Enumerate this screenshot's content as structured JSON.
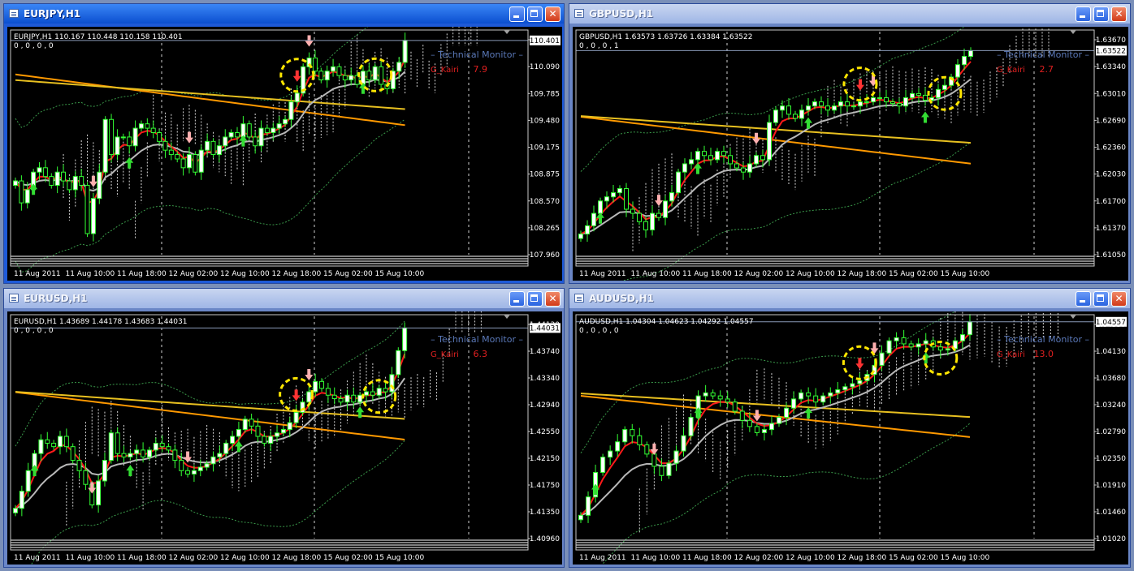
{
  "windows": [
    {
      "title": "EURJPY,H1",
      "active": true,
      "ohlc_line": "EURJPY,H1  110.167 110.448 110.158 110.401",
      "indicator_values": "0 , 0 , 0 , 0",
      "monitor": {
        "label": "Technical  Monitor",
        "name": "G_Kairi",
        "value": "7.9"
      },
      "current_price": "110.401",
      "price_labels": [
        "110.395",
        "110.090",
        "109.785",
        "109.480",
        "109.175",
        "108.875",
        "108.570",
        "108.265",
        "107.960"
      ],
      "time_labels": [
        "11 Aug 2011",
        "11 Aug 10:00",
        "11 Aug 18:00",
        "12 Aug 02:00",
        "12 Aug 10:00",
        "12 Aug 18:00",
        "15 Aug 02:00",
        "15 Aug 10:00"
      ],
      "chart_data": {
        "type": "candlestick",
        "ylim": [
          107.96,
          110.5
        ],
        "closes": [
          108.8,
          108.55,
          108.7,
          108.9,
          108.95,
          108.85,
          108.75,
          108.9,
          108.8,
          108.7,
          108.85,
          108.75,
          108.2,
          108.6,
          108.9,
          109.5,
          109.1,
          109.3,
          109.3,
          109.2,
          109.4,
          109.45,
          109.4,
          109.35,
          109.25,
          109.15,
          109.1,
          109.05,
          108.95,
          109.1,
          108.9,
          109.15,
          109.25,
          109.1,
          109.2,
          109.3,
          109.35,
          109.3,
          109.45,
          109.3,
          109.2,
          109.4,
          109.35,
          109.4,
          109.45,
          109.5,
          109.7,
          109.8,
          110.1,
          110.2,
          110.05,
          109.95,
          110.05,
          110.1,
          110.0,
          109.95,
          110.0,
          109.9,
          110.05,
          109.95,
          110.1,
          109.9,
          109.85,
          110.05,
          110.15,
          110.4
        ]
      }
    },
    {
      "title": "GBPUSD,H1",
      "active": false,
      "ohlc_line": "GBPUSD,H1  1.63573 1.63726 1.63384 1.63522",
      "indicator_values": "0 , 0 , 0 , 1",
      "monitor": {
        "label": "Technical  Monitor",
        "name": "G_Kairi",
        "value": "2.7"
      },
      "current_price": "1.63522",
      "price_labels": [
        "1.63670",
        "1.63340",
        "1.63010",
        "1.62690",
        "1.62360",
        "1.62030",
        "1.61700",
        "1.61370",
        "1.61050"
      ],
      "time_labels": [
        "11 Aug 2011",
        "11 Aug 10:00",
        "11 Aug 18:00",
        "12 Aug 02:00",
        "12 Aug 10:00",
        "12 Aug 18:00",
        "15 Aug 02:00",
        "15 Aug 10:00"
      ],
      "chart_data": {
        "type": "candlestick",
        "ylim": [
          1.6105,
          1.6375
        ],
        "closes": [
          1.613,
          1.614,
          1.6155,
          1.617,
          1.6175,
          1.618,
          1.6185,
          1.616,
          1.6155,
          1.6145,
          1.6135,
          1.6155,
          1.615,
          1.617,
          1.618,
          1.6205,
          1.6215,
          1.622,
          1.623,
          1.6225,
          1.622,
          1.623,
          1.6225,
          1.6215,
          1.621,
          1.6205,
          1.6215,
          1.6225,
          1.622,
          1.6265,
          1.628,
          1.6285,
          1.6275,
          1.627,
          1.628,
          1.6285,
          1.629,
          1.6285,
          1.628,
          1.6285,
          1.629,
          1.6285,
          1.6285,
          1.629,
          1.629,
          1.6295,
          1.6295,
          1.629,
          1.6288,
          1.6285,
          1.6295,
          1.63,
          1.6298,
          1.6292,
          1.6295,
          1.6305,
          1.631,
          1.632,
          1.6335,
          1.6345,
          1.6352
        ]
      }
    },
    {
      "title": "EURUSD,H1",
      "active": false,
      "ohlc_line": "EURUSD,H1  1.43689 1.44178 1.43683 1.44031",
      "indicator_values": "0 , 0 , 0 , 0",
      "monitor": {
        "label": "Technical  Monitor",
        "name": "G_Kairi",
        "value": "6.3"
      },
      "current_price": "1.44031",
      "price_labels": [
        "1.44130",
        "1.43740",
        "1.43340",
        "1.42940",
        "1.42550",
        "1.42150",
        "1.41750",
        "1.41350",
        "1.40960"
      ],
      "time_labels": [
        "11 Aug 2011",
        "11 Aug 10:00",
        "11 Aug 18:00",
        "12 Aug 02:00",
        "12 Aug 10:00",
        "12 Aug 18:00",
        "15 Aug 02:00",
        "15 Aug 10:00"
      ],
      "chart_data": {
        "type": "candlestick",
        "ylim": [
          1.4096,
          1.442
        ],
        "closes": [
          1.414,
          1.4165,
          1.4195,
          1.422,
          1.424,
          1.4235,
          1.423,
          1.4245,
          1.423,
          1.421,
          1.4195,
          1.4175,
          1.4145,
          1.418,
          1.421,
          1.425,
          1.422,
          1.4215,
          1.422,
          1.4225,
          1.4215,
          1.4225,
          1.4235,
          1.423,
          1.4225,
          1.421,
          1.4195,
          1.419,
          1.4195,
          1.42,
          1.4205,
          1.4215,
          1.422,
          1.4235,
          1.4245,
          1.4255,
          1.427,
          1.426,
          1.4245,
          1.4235,
          1.4245,
          1.425,
          1.4255,
          1.4265,
          1.428,
          1.4295,
          1.431,
          1.4325,
          1.4315,
          1.4305,
          1.43,
          1.4295,
          1.4305,
          1.4295,
          1.4305,
          1.431,
          1.4305,
          1.4315,
          1.431,
          1.4335,
          1.437,
          1.4403
        ]
      }
    },
    {
      "title": "AUDUSD,H1",
      "active": false,
      "ohlc_line": "AUDUSD,H1  1.04304 1.04623 1.04292 1.04557",
      "indicator_values": "0 , 0 , 0 , 0",
      "monitor": {
        "label": "Technical  Monitor",
        "name": "G_Kairi",
        "value": "13.0"
      },
      "current_price": "1.04557",
      "price_labels": [
        "1.04557",
        "1.04130",
        "1.03680",
        "1.03240",
        "1.02790",
        "1.02350",
        "1.01910",
        "1.01460",
        "1.01020"
      ],
      "time_labels": [
        "11 Aug 2011",
        "11 Aug 10:00",
        "11 Aug 18:00",
        "12 Aug 02:00",
        "12 Aug 10:00",
        "12 Aug 18:00",
        "15 Aug 02:00",
        "15 Aug 10:00"
      ],
      "chart_data": {
        "type": "candlestick",
        "ylim": [
          1.0102,
          1.0465
        ],
        "closes": [
          1.014,
          1.017,
          1.021,
          1.0235,
          1.0245,
          1.026,
          1.028,
          1.027,
          1.0255,
          1.024,
          1.022,
          1.0205,
          1.0225,
          1.0245,
          1.027,
          1.03,
          1.0335,
          1.034,
          1.0335,
          1.033,
          1.0325,
          1.031,
          1.0295,
          1.0285,
          1.0275,
          1.028,
          1.029,
          1.03,
          1.0315,
          1.033,
          1.034,
          1.0335,
          1.0325,
          1.0335,
          1.034,
          1.0345,
          1.035,
          1.0355,
          1.036,
          1.037,
          1.0385,
          1.0405,
          1.0425,
          1.043,
          1.042,
          1.0415,
          1.042,
          1.0425,
          1.0415,
          1.041,
          1.0412,
          1.0425,
          1.0435,
          1.0456
        ]
      }
    }
  ]
}
